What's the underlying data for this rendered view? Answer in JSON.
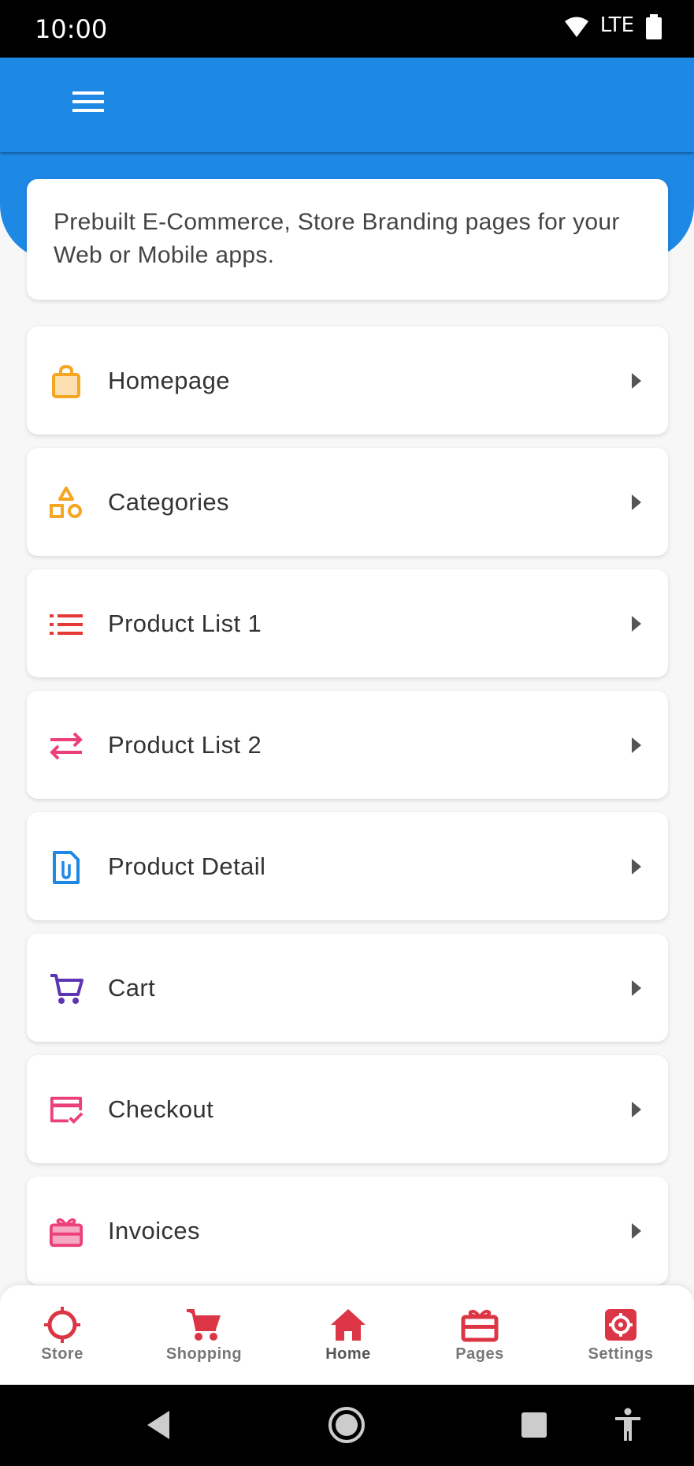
{
  "status_bar": {
    "time": "10:00",
    "network": "LTE",
    "icons": [
      "wifi-icon",
      "battery-icon"
    ]
  },
  "app_bar": {
    "menu_icon": "hamburger-menu-icon",
    "color": "#1e88e5"
  },
  "intro": {
    "text": "Prebuilt E-Commerce, Store Branding pages for your Web or Mobile apps."
  },
  "menu_items": [
    {
      "label": "Homepage",
      "icon": "shopping-bag-icon",
      "color": "#f5a623"
    },
    {
      "label": "Categories",
      "icon": "shapes-icon",
      "color": "#f5a623"
    },
    {
      "label": "Product List 1",
      "icon": "list-icon",
      "color": "#e53935"
    },
    {
      "label": "Product List 2",
      "icon": "swap-arrows-icon",
      "color": "#ec407a"
    },
    {
      "label": "Product Detail",
      "icon": "attachment-document-icon",
      "color": "#1e88e5"
    },
    {
      "label": "Cart",
      "icon": "cart-icon",
      "color": "#5e35b1"
    },
    {
      "label": "Checkout",
      "icon": "card-check-icon",
      "color": "#ec407a"
    },
    {
      "label": "Invoices",
      "icon": "gift-card-icon",
      "color": "#ec407a"
    }
  ],
  "bottom_nav": {
    "accent": "#dc3545",
    "items": [
      {
        "label": "Store",
        "icon": "target-icon"
      },
      {
        "label": "Shopping",
        "icon": "cart-icon"
      },
      {
        "label": "Home",
        "icon": "home-icon"
      },
      {
        "label": "Pages",
        "icon": "gift-card-icon"
      },
      {
        "label": "Settings",
        "icon": "gear-icon"
      }
    ]
  },
  "system_nav": {
    "icons": [
      "back-icon",
      "home-circle-icon",
      "recents-icon",
      "accessibility-icon"
    ]
  }
}
